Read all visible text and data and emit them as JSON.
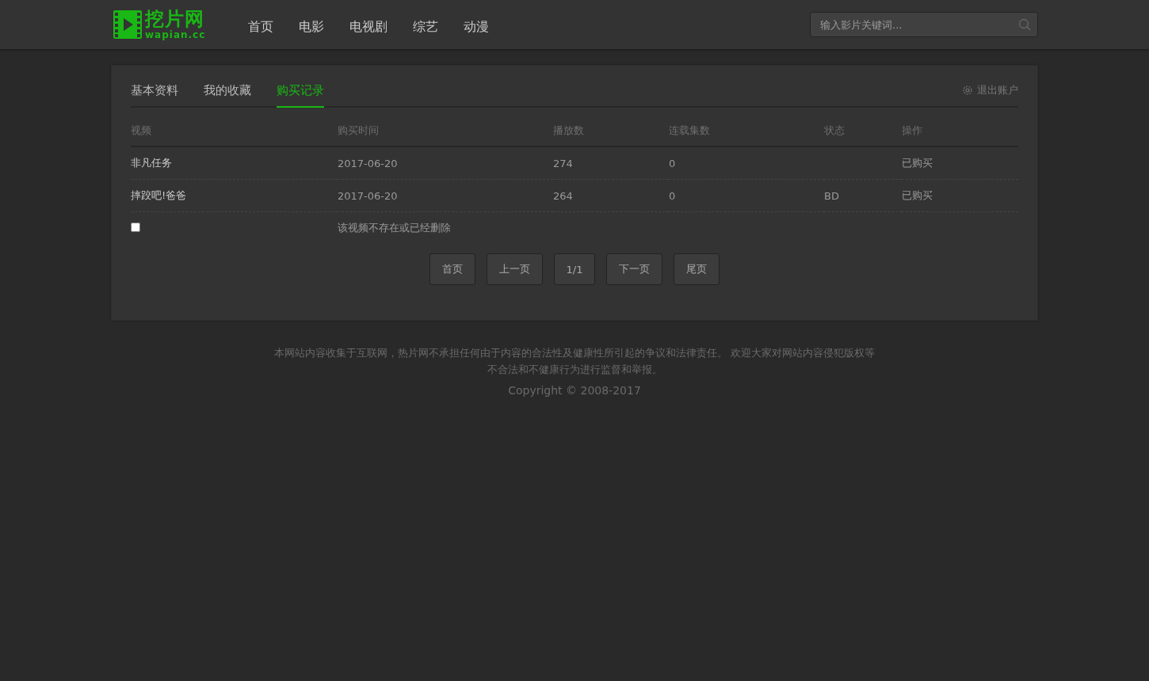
{
  "header": {
    "logo": {
      "name": "挖片网",
      "domain": "wapian.cc"
    },
    "nav": [
      {
        "label": "首页"
      },
      {
        "label": "电影"
      },
      {
        "label": "电视剧"
      },
      {
        "label": "综艺"
      },
      {
        "label": "动漫"
      }
    ],
    "search": {
      "placeholder": "输入影片关键词..."
    }
  },
  "tabs": [
    {
      "label": "基本资料",
      "selected": false
    },
    {
      "label": "我的收藏",
      "selected": false
    },
    {
      "label": "购买记录",
      "selected": true
    }
  ],
  "logout": "退出账户",
  "table": {
    "columns": [
      "视频",
      "购买时间",
      "播放数",
      "连载集数",
      "状态",
      "操作"
    ],
    "rows": [
      {
        "kind": "item",
        "cells": [
          "非凡任务",
          "2017-06-20",
          "274",
          "0",
          "",
          "已购买"
        ]
      },
      {
        "kind": "item",
        "cells": [
          "摔跤吧!爸爸",
          "2017-06-20",
          "264",
          "0",
          "BD",
          "已购买"
        ]
      },
      {
        "kind": "missing",
        "checked": false,
        "message": "该视频不存在或已经删除"
      }
    ]
  },
  "pagination": [
    "首页",
    "上一页",
    "1/1",
    "下一页",
    "尾页"
  ],
  "footer": {
    "notice": "本网站内容收集于互联网，热片网不承担任何由于内容的合法性及健康性所引起的争议和法律责任。 欢迎大家对网站内容侵犯版权等不合法和不健康行为进行监督和举报。",
    "copyright": "Copyright © 2008-2017"
  }
}
